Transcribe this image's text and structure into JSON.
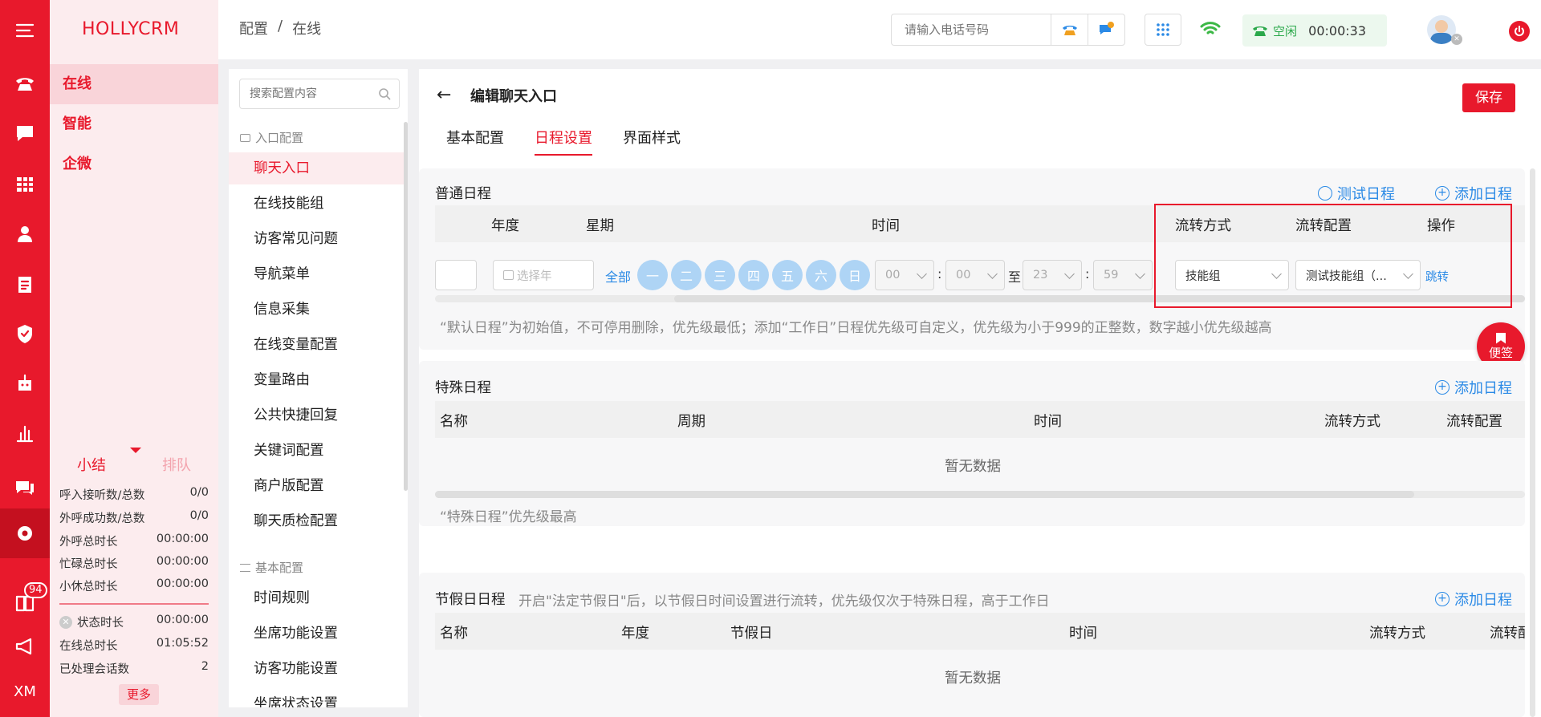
{
  "brand": "HOLLYCRM",
  "rail": {
    "icons": [
      "menu-icon",
      "phone-icon",
      "chat-icon",
      "grid-icon",
      "person-icon",
      "clipboard-icon",
      "shield-icon",
      "robot-icon",
      "bar-chart-icon",
      "message-icon",
      "settings-icon",
      "book-icon",
      "megaphone-icon"
    ],
    "badge": "94",
    "bottom_label": "XM"
  },
  "nav": {
    "items": [
      {
        "label": "在线"
      },
      {
        "label": "智能"
      },
      {
        "label": "企微"
      }
    ],
    "stats_tabs": [
      "小结",
      "排队"
    ],
    "stats": [
      {
        "label": "呼入接听数/总数",
        "value": "0/0"
      },
      {
        "label": "外呼成功数/总数",
        "value": "0/0"
      },
      {
        "label": "外呼总时长",
        "value": "00:00:00"
      },
      {
        "label": "忙碌总时长",
        "value": "00:00:00"
      },
      {
        "label": "小休总时长",
        "value": "00:00:00"
      },
      {
        "label": "状态时长",
        "value": "00:00:00"
      },
      {
        "label": "在线总时长",
        "value": "01:05:52"
      },
      {
        "label": "已处理会话数",
        "value": "2"
      }
    ],
    "more_label": "更多"
  },
  "header": {
    "breadcrumb": [
      "配置",
      "/",
      "在线"
    ],
    "phone_placeholder": "请输入电话号码",
    "status_label": "空闲",
    "timer": "00:00:33"
  },
  "config": {
    "search_placeholder": "搜索配置内容",
    "group1": "入口配置",
    "items1": [
      "聊天入口",
      "在线技能组",
      "访客常见问题",
      "导航菜单",
      "信息采集",
      "在线变量配置",
      "变量路由",
      "公共快捷回复",
      "关键词配置",
      "商户版配置",
      "聊天质检配置"
    ],
    "group2": "基本配置",
    "items2": [
      "时间规则",
      "坐席功能设置",
      "访客功能设置",
      "坐席状态设置"
    ]
  },
  "main": {
    "back_icon": "arrow-left-icon",
    "title": "编辑聊天入口",
    "save_label": "保存",
    "tabs": [
      "基本配置",
      "日程设置",
      "界面样式"
    ],
    "active_tab": 1,
    "sticky_label": "便签",
    "normal": {
      "title": "普通日程",
      "test_label": "测试日程",
      "add_label": "添加日程",
      "headers": [
        "年度",
        "星期",
        "时间",
        "流转方式",
        "流转配置",
        "操作"
      ],
      "year_placeholder": "选择年",
      "all_label": "全部",
      "days": [
        "一",
        "二",
        "三",
        "四",
        "五",
        "六",
        "日"
      ],
      "start_hour": "00",
      "start_min": "00",
      "to_label": "至",
      "end_hour": "23",
      "end_min": "59",
      "colon": ":",
      "flow_mode": "技能组",
      "flow_config": "测试技能组（...",
      "action": "跳转",
      "note": "“默认日程”为初始值，不可停用删除，优先级最低；添加“工作日”日程优先级可自定义，优先级为小于999的正整数，数字越小优先级越高"
    },
    "special": {
      "title": "特殊日程",
      "add_label": "添加日程",
      "headers": [
        "名称",
        "周期",
        "时间",
        "流转方式",
        "流转配置"
      ],
      "empty": "暂无数据",
      "note": "“特殊日程”优先级最高"
    },
    "holiday": {
      "title": "节假日日程",
      "desc": "开启\"法定节假日\"后，以节假日时间设置进行流转，优先级仅次于特殊日程，高于工作日",
      "add_label": "添加日程",
      "headers": [
        "名称",
        "年度",
        "节假日",
        "时间",
        "流转方式",
        "流转配"
      ],
      "empty": "暂无数据"
    }
  },
  "colors": {
    "brand": "#e8192c",
    "link": "#2b8ae6",
    "highlight": "#e8192c"
  }
}
